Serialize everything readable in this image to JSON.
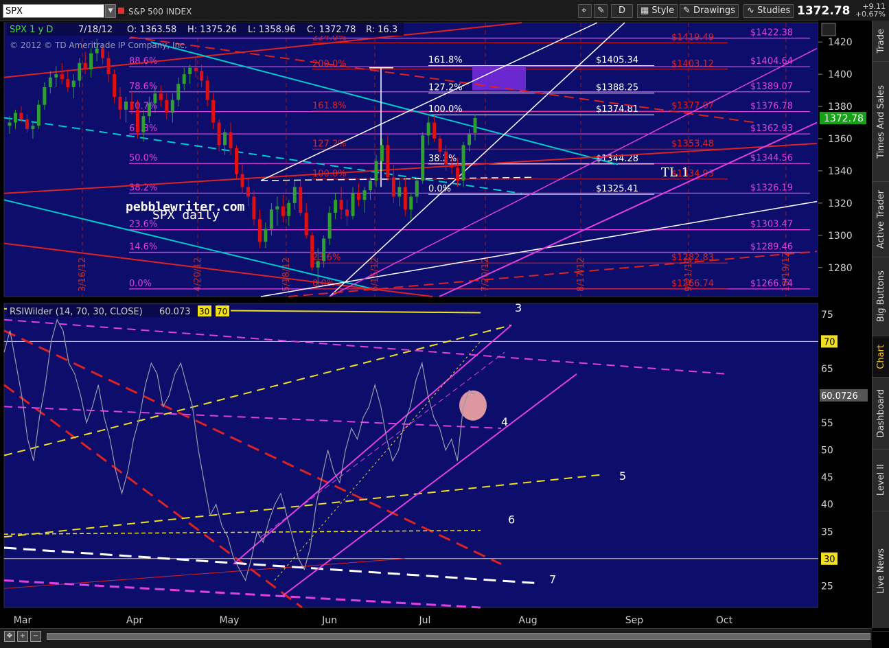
{
  "toolbar": {
    "symbol": "SPX",
    "description": "S&P 500 INDEX",
    "style_label": "Style",
    "drawings_label": "Drawings",
    "studies_label": "Studies",
    "d_label": "D",
    "last_price": "1372.78",
    "change": "+9.11",
    "change_pct": "+0.67%"
  },
  "side_tabs": [
    "Trade",
    "Times And Sales",
    "Active Trader",
    "Big Buttons",
    "Chart",
    "Dashboard",
    "Level II",
    "Live News"
  ],
  "active_side_tab": "Chart",
  "colors": {
    "panel_bg": "#0d0d6b",
    "bull": "#2f9f2f",
    "bear": "#dd1111",
    "fib_magenta": "#e040e0",
    "fib_red": "#dd2222",
    "fib_white": "#ffffff",
    "cyan": "#00cccc",
    "yellow": "#f0e020"
  },
  "chart_data": [
    {
      "type": "candlestick",
      "panel": "price",
      "header": {
        "symbol_period": "SPX 1 y D",
        "date": "7/18/12",
        "open": "O: 1363.58",
        "high": "H: 1375.26",
        "low": "L: 1358.96",
        "close": "C: 1372.78",
        "range": "R: 16.3"
      },
      "copyright": "© 2012 © TD Ameritrade IP Company, Inc.",
      "annotations": [
        "pebblewriter.com",
        "SPX daily",
        "TL 1"
      ],
      "y_ticks": [
        1280,
        1300,
        1320,
        1340,
        1360,
        1380,
        1400,
        1420
      ],
      "ylim": [
        1262,
        1432
      ],
      "last_price_label": "1372.78",
      "x_months": [
        "Mar",
        "Apr",
        "May",
        "Jun",
        "Jul",
        "Aug",
        "Sep",
        "Oct"
      ],
      "vertical_date_labels": [
        "3/16/12",
        "4/20/12",
        "5/18/12",
        "6/15/12",
        "7/20/12",
        "8/17/12",
        "9/21/12",
        "10/19/12"
      ],
      "fib_left_magenta": [
        {
          "label": "100.0%",
          "value": 1422.38
        },
        {
          "label": "88.6%",
          "value": 1404.64
        },
        {
          "label": "78.6%",
          "value": 1389.07
        },
        {
          "label": "70.7%",
          "value": 1376.78
        },
        {
          "label": "61.8%",
          "value": 1362.93
        },
        {
          "label": "50.0%",
          "value": 1344.56
        },
        {
          "label": "38.2%",
          "value": 1326.19
        },
        {
          "label": "23.6%",
          "value": 1303.47
        },
        {
          "label": "14.6%",
          "value": 1289.46
        },
        {
          "label": "0.0%",
          "value": 1266.74
        }
      ],
      "fib_red_ext": [
        {
          "label": "224.0%",
          "value": 1419.49
        },
        {
          "label": "200.0%",
          "value": 1403.12
        },
        {
          "label": "161.8%",
          "value": 1377.07
        },
        {
          "label": "127.2%",
          "value": 1353.48
        },
        {
          "label": "100.0%",
          "value": 1334.93
        },
        {
          "label": "23.6%",
          "value": 1282.83
        },
        {
          "label": "0.0%",
          "value": 1266.74
        }
      ],
      "fib_white_ext": [
        {
          "label": "161.8%",
          "value": 1405.34
        },
        {
          "label": "127.2%",
          "value": 1388.25
        },
        {
          "label": "100.0%",
          "value": 1374.81
        },
        {
          "label": "38.2%",
          "value": 1344.28
        },
        {
          "label": "0.0%",
          "value": 1325.41
        }
      ],
      "right_magenta_labels": [
        "$1422.38",
        "$1404.64",
        "$1389.07",
        "$1376.78",
        "$1362.93",
        "$1344.56",
        "$1326.19",
        "$1303.47",
        "$1289.46",
        "$1266.74"
      ],
      "right_red_labels": [
        "$1419.49",
        "$1403.12",
        "$1377.07",
        "$1353.48",
        "$1334.93",
        "$1282.83",
        "$1266.74"
      ],
      "white_value_labels": [
        "$1405.34",
        "$1388.25",
        "$1374.81",
        "$1344.28",
        "$1325.41"
      ],
      "ohlc": [
        [
          1368,
          1374,
          1363,
          1370
        ],
        [
          1370,
          1378,
          1366,
          1376
        ],
        [
          1376,
          1380,
          1370,
          1372
        ],
        [
          1372,
          1375,
          1364,
          1366
        ],
        [
          1366,
          1370,
          1360,
          1368
        ],
        [
          1368,
          1384,
          1366,
          1381
        ],
        [
          1381,
          1395,
          1378,
          1392
        ],
        [
          1392,
          1402,
          1388,
          1398
        ],
        [
          1398,
          1405,
          1392,
          1400
        ],
        [
          1400,
          1407,
          1394,
          1397
        ],
        [
          1397,
          1403,
          1389,
          1392
        ],
        [
          1392,
          1400,
          1385,
          1396
        ],
        [
          1396,
          1410,
          1392,
          1407
        ],
        [
          1407,
          1414,
          1400,
          1403
        ],
        [
          1403,
          1416,
          1398,
          1413
        ],
        [
          1413,
          1422,
          1408,
          1416
        ],
        [
          1416,
          1419,
          1406,
          1410
        ],
        [
          1410,
          1414,
          1395,
          1400
        ],
        [
          1400,
          1403,
          1382,
          1386
        ],
        [
          1386,
          1392,
          1372,
          1378
        ],
        [
          1378,
          1386,
          1370,
          1383
        ],
        [
          1383,
          1390,
          1375,
          1378
        ],
        [
          1378,
          1384,
          1360,
          1364
        ],
        [
          1364,
          1378,
          1358,
          1374
        ],
        [
          1374,
          1386,
          1370,
          1382
        ],
        [
          1382,
          1392,
          1376,
          1388
        ],
        [
          1388,
          1393,
          1380,
          1384
        ],
        [
          1384,
          1388,
          1372,
          1376
        ],
        [
          1376,
          1388,
          1370,
          1384
        ],
        [
          1384,
          1398,
          1380,
          1394
        ],
        [
          1394,
          1404,
          1390,
          1400
        ],
        [
          1400,
          1406,
          1394,
          1404
        ],
        [
          1404,
          1410,
          1398,
          1402
        ],
        [
          1402,
          1406,
          1392,
          1396
        ],
        [
          1396,
          1399,
          1380,
          1384
        ],
        [
          1384,
          1388,
          1366,
          1370
        ],
        [
          1370,
          1372,
          1352,
          1356
        ],
        [
          1356,
          1366,
          1350,
          1364
        ],
        [
          1364,
          1370,
          1350,
          1354
        ],
        [
          1354,
          1356,
          1335,
          1338
        ],
        [
          1338,
          1344,
          1326,
          1330
        ],
        [
          1330,
          1336,
          1318,
          1324
        ],
        [
          1324,
          1328,
          1306,
          1310
        ],
        [
          1310,
          1316,
          1292,
          1296
        ],
        [
          1296,
          1308,
          1292,
          1304
        ],
        [
          1304,
          1320,
          1300,
          1316
        ],
        [
          1316,
          1324,
          1306,
          1318
        ],
        [
          1318,
          1325,
          1308,
          1312
        ],
        [
          1312,
          1322,
          1306,
          1320
        ],
        [
          1320,
          1334,
          1316,
          1330
        ],
        [
          1330,
          1334,
          1312,
          1314
        ],
        [
          1314,
          1320,
          1298,
          1300
        ],
        [
          1300,
          1302,
          1278,
          1280
        ],
        [
          1280,
          1292,
          1268,
          1284
        ],
        [
          1284,
          1300,
          1280,
          1298
        ],
        [
          1298,
          1318,
          1294,
          1314
        ],
        [
          1314,
          1326,
          1310,
          1322
        ],
        [
          1322,
          1330,
          1310,
          1316
        ],
        [
          1316,
          1322,
          1306,
          1312
        ],
        [
          1312,
          1330,
          1310,
          1326
        ],
        [
          1326,
          1332,
          1318,
          1322
        ],
        [
          1322,
          1330,
          1314,
          1328
        ],
        [
          1328,
          1336,
          1322,
          1334
        ],
        [
          1334,
          1350,
          1330,
          1346
        ],
        [
          1346,
          1360,
          1340,
          1356
        ],
        [
          1356,
          1362,
          1334,
          1336
        ],
        [
          1336,
          1344,
          1320,
          1324
        ],
        [
          1324,
          1334,
          1318,
          1330
        ],
        [
          1330,
          1336,
          1312,
          1316
        ],
        [
          1316,
          1326,
          1310,
          1324
        ],
        [
          1324,
          1336,
          1320,
          1334
        ],
        [
          1334,
          1364,
          1332,
          1362
        ],
        [
          1362,
          1374,
          1356,
          1370
        ],
        [
          1370,
          1374,
          1358,
          1360
        ],
        [
          1360,
          1362,
          1348,
          1352
        ],
        [
          1352,
          1356,
          1340,
          1344
        ],
        [
          1344,
          1350,
          1338,
          1342
        ],
        [
          1342,
          1348,
          1330,
          1334
        ],
        [
          1334,
          1358,
          1330,
          1356
        ],
        [
          1356,
          1366,
          1352,
          1363
        ],
        [
          1363.58,
          1375.26,
          1358.96,
          1372.78
        ]
      ]
    },
    {
      "type": "line",
      "panel": "indicator",
      "header": "RSIWilder (14, 70, 30, CLOSE)",
      "header_value": "60.073",
      "overbought_label": "30",
      "oversold_label": "70",
      "y_ticks": [
        25,
        30,
        35,
        40,
        45,
        50,
        55,
        60,
        65,
        70,
        75
      ],
      "ylim": [
        21,
        77
      ],
      "levels": [
        30,
        70
      ],
      "last_value_label": "60.0726",
      "line_labels": [
        "3",
        "4",
        "5",
        "6",
        "7"
      ],
      "series": [
        {
          "values": [
            68,
            72,
            66,
            60,
            52,
            48,
            56,
            62,
            70,
            74,
            72,
            66,
            64,
            60,
            55,
            58,
            62,
            56,
            52,
            46,
            42,
            46,
            52,
            56,
            62,
            66,
            64,
            58,
            60,
            64,
            66,
            62,
            58,
            50,
            44,
            38,
            40,
            36,
            34,
            30,
            28,
            26,
            30,
            35,
            33,
            37,
            40,
            42,
            38,
            34,
            30,
            28,
            32,
            40,
            45,
            50,
            46,
            44,
            50,
            54,
            52,
            56,
            58,
            62,
            58,
            52,
            48,
            50,
            55,
            58,
            63,
            66,
            60,
            56,
            54,
            50,
            52,
            48,
            58,
            61,
            60.07
          ]
        }
      ]
    }
  ]
}
